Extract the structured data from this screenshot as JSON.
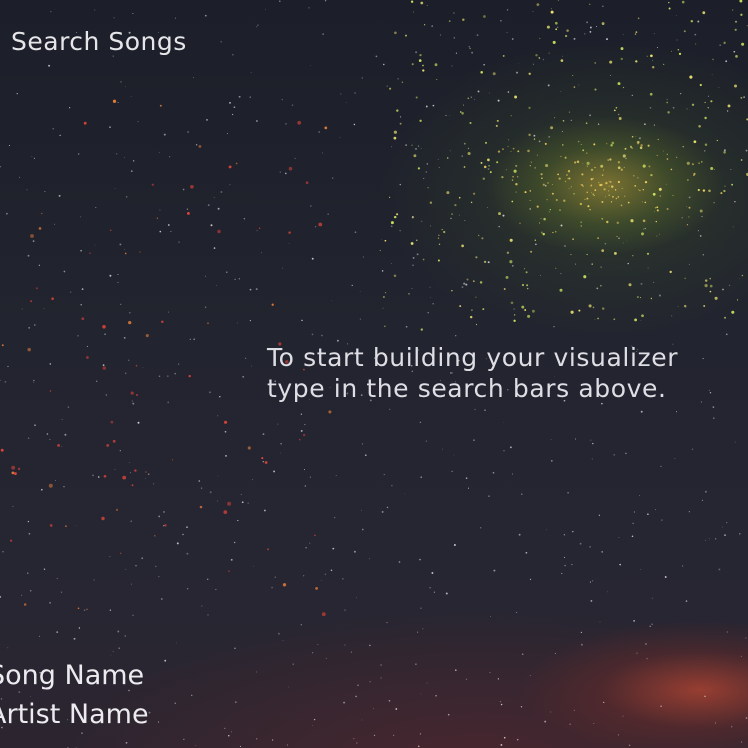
{
  "search": {
    "label": "Search Songs"
  },
  "instructions": {
    "line1": "To start building your visualizer",
    "line2": "type in the search bars above."
  },
  "now_playing": {
    "song_name": "Song Name",
    "artist_name": "Artist Name"
  },
  "colors": {
    "text": "#e6e6ea",
    "sky": "#1d1f2a",
    "nebula": "#c9a23c",
    "glow": "#b8483a"
  }
}
